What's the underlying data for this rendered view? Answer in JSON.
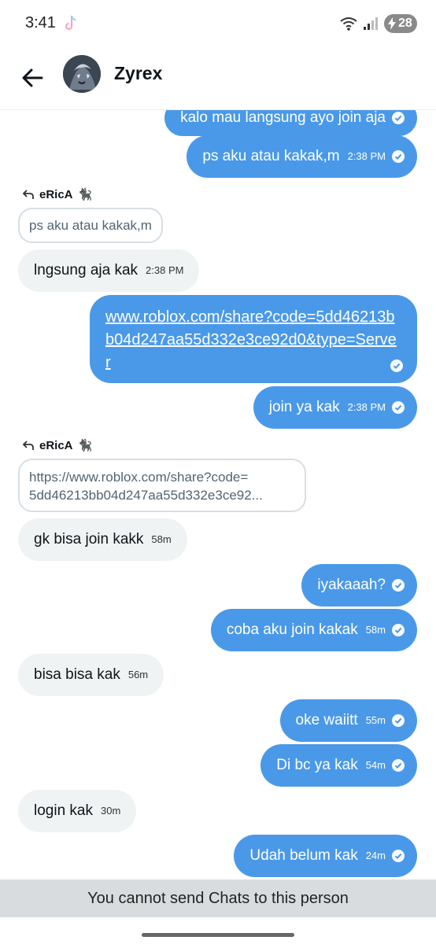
{
  "status_bar": {
    "time": "3:41",
    "battery": "28"
  },
  "header": {
    "contact_name": "Zyrex"
  },
  "messages": [
    {
      "text": "kalo mau langsung ayo join aja"
    },
    {
      "text": "ps aku atau kakak,m",
      "time": "2:38 PM"
    },
    {
      "reply_to": "eRicA",
      "quote": "ps aku atau kakak,m"
    },
    {
      "text": "lngsung aja kak",
      "time": "2:38 PM"
    },
    {
      "link": "www.roblox.com/share?code=5dd46213bb04d247aa55d332e3ce92d0&type=Server"
    },
    {
      "text": "join ya kak",
      "time": "2:38 PM"
    },
    {
      "reply_to": "eRicA",
      "quote_line1": "https://www.roblox.com/share?code=",
      "quote_line2": "5dd46213bb04d247aa55d332e3ce92..."
    },
    {
      "text": "gk bisa join kakk",
      "time": "58m"
    },
    {
      "text": "iyakaaah?"
    },
    {
      "text": "coba aku join kakak",
      "time": "58m"
    },
    {
      "text": "bisa bisa kak",
      "time": "56m"
    },
    {
      "text": "oke waiitt",
      "time": "55m"
    },
    {
      "text": "Di bc ya kak",
      "time": "54m"
    },
    {
      "text": "login kak",
      "time": "30m"
    },
    {
      "text": "Udah belum kak",
      "time": "24m"
    }
  ],
  "footer": {
    "notice": "You cannot send Chats to this person"
  },
  "colors": {
    "sent_bubble": "#4a99e9",
    "received_bubble": "#eff3f4",
    "banner": "#d9dcdf"
  }
}
